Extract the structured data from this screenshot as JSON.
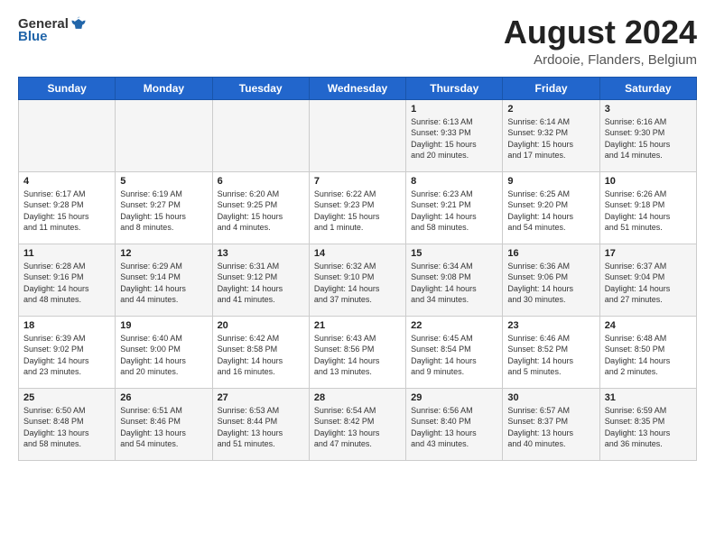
{
  "logo": {
    "general": "General",
    "blue": "Blue"
  },
  "title": "August 2024",
  "subtitle": "Ardooie, Flanders, Belgium",
  "weekdays": [
    "Sunday",
    "Monday",
    "Tuesday",
    "Wednesday",
    "Thursday",
    "Friday",
    "Saturday"
  ],
  "weeks": [
    [
      {
        "day": "",
        "info": ""
      },
      {
        "day": "",
        "info": ""
      },
      {
        "day": "",
        "info": ""
      },
      {
        "day": "",
        "info": ""
      },
      {
        "day": "1",
        "info": "Sunrise: 6:13 AM\nSunset: 9:33 PM\nDaylight: 15 hours\nand 20 minutes."
      },
      {
        "day": "2",
        "info": "Sunrise: 6:14 AM\nSunset: 9:32 PM\nDaylight: 15 hours\nand 17 minutes."
      },
      {
        "day": "3",
        "info": "Sunrise: 6:16 AM\nSunset: 9:30 PM\nDaylight: 15 hours\nand 14 minutes."
      }
    ],
    [
      {
        "day": "4",
        "info": "Sunrise: 6:17 AM\nSunset: 9:28 PM\nDaylight: 15 hours\nand 11 minutes."
      },
      {
        "day": "5",
        "info": "Sunrise: 6:19 AM\nSunset: 9:27 PM\nDaylight: 15 hours\nand 8 minutes."
      },
      {
        "day": "6",
        "info": "Sunrise: 6:20 AM\nSunset: 9:25 PM\nDaylight: 15 hours\nand 4 minutes."
      },
      {
        "day": "7",
        "info": "Sunrise: 6:22 AM\nSunset: 9:23 PM\nDaylight: 15 hours\nand 1 minute."
      },
      {
        "day": "8",
        "info": "Sunrise: 6:23 AM\nSunset: 9:21 PM\nDaylight: 14 hours\nand 58 minutes."
      },
      {
        "day": "9",
        "info": "Sunrise: 6:25 AM\nSunset: 9:20 PM\nDaylight: 14 hours\nand 54 minutes."
      },
      {
        "day": "10",
        "info": "Sunrise: 6:26 AM\nSunset: 9:18 PM\nDaylight: 14 hours\nand 51 minutes."
      }
    ],
    [
      {
        "day": "11",
        "info": "Sunrise: 6:28 AM\nSunset: 9:16 PM\nDaylight: 14 hours\nand 48 minutes."
      },
      {
        "day": "12",
        "info": "Sunrise: 6:29 AM\nSunset: 9:14 PM\nDaylight: 14 hours\nand 44 minutes."
      },
      {
        "day": "13",
        "info": "Sunrise: 6:31 AM\nSunset: 9:12 PM\nDaylight: 14 hours\nand 41 minutes."
      },
      {
        "day": "14",
        "info": "Sunrise: 6:32 AM\nSunset: 9:10 PM\nDaylight: 14 hours\nand 37 minutes."
      },
      {
        "day": "15",
        "info": "Sunrise: 6:34 AM\nSunset: 9:08 PM\nDaylight: 14 hours\nand 34 minutes."
      },
      {
        "day": "16",
        "info": "Sunrise: 6:36 AM\nSunset: 9:06 PM\nDaylight: 14 hours\nand 30 minutes."
      },
      {
        "day": "17",
        "info": "Sunrise: 6:37 AM\nSunset: 9:04 PM\nDaylight: 14 hours\nand 27 minutes."
      }
    ],
    [
      {
        "day": "18",
        "info": "Sunrise: 6:39 AM\nSunset: 9:02 PM\nDaylight: 14 hours\nand 23 minutes."
      },
      {
        "day": "19",
        "info": "Sunrise: 6:40 AM\nSunset: 9:00 PM\nDaylight: 14 hours\nand 20 minutes."
      },
      {
        "day": "20",
        "info": "Sunrise: 6:42 AM\nSunset: 8:58 PM\nDaylight: 14 hours\nand 16 minutes."
      },
      {
        "day": "21",
        "info": "Sunrise: 6:43 AM\nSunset: 8:56 PM\nDaylight: 14 hours\nand 13 minutes."
      },
      {
        "day": "22",
        "info": "Sunrise: 6:45 AM\nSunset: 8:54 PM\nDaylight: 14 hours\nand 9 minutes."
      },
      {
        "day": "23",
        "info": "Sunrise: 6:46 AM\nSunset: 8:52 PM\nDaylight: 14 hours\nand 5 minutes."
      },
      {
        "day": "24",
        "info": "Sunrise: 6:48 AM\nSunset: 8:50 PM\nDaylight: 14 hours\nand 2 minutes."
      }
    ],
    [
      {
        "day": "25",
        "info": "Sunrise: 6:50 AM\nSunset: 8:48 PM\nDaylight: 13 hours\nand 58 minutes."
      },
      {
        "day": "26",
        "info": "Sunrise: 6:51 AM\nSunset: 8:46 PM\nDaylight: 13 hours\nand 54 minutes."
      },
      {
        "day": "27",
        "info": "Sunrise: 6:53 AM\nSunset: 8:44 PM\nDaylight: 13 hours\nand 51 minutes."
      },
      {
        "day": "28",
        "info": "Sunrise: 6:54 AM\nSunset: 8:42 PM\nDaylight: 13 hours\nand 47 minutes."
      },
      {
        "day": "29",
        "info": "Sunrise: 6:56 AM\nSunset: 8:40 PM\nDaylight: 13 hours\nand 43 minutes."
      },
      {
        "day": "30",
        "info": "Sunrise: 6:57 AM\nSunset: 8:37 PM\nDaylight: 13 hours\nand 40 minutes."
      },
      {
        "day": "31",
        "info": "Sunrise: 6:59 AM\nSunset: 8:35 PM\nDaylight: 13 hours\nand 36 minutes."
      }
    ]
  ]
}
